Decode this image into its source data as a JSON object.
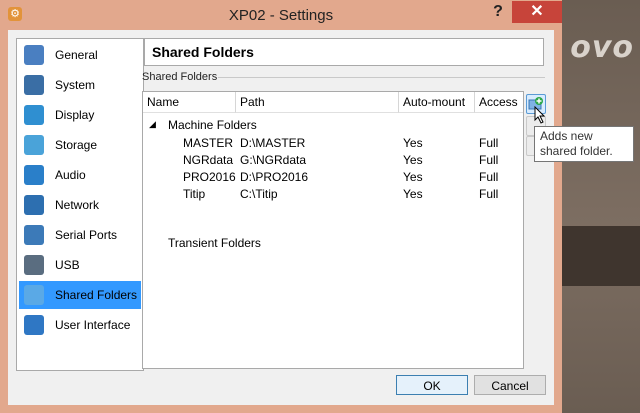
{
  "window": {
    "title": "XP02 - Settings",
    "help": "?",
    "close": "✕"
  },
  "desktop": {
    "brand": "ovo"
  },
  "nav": [
    {
      "label": "General",
      "icon": "general-icon",
      "color": "#4a7fc1"
    },
    {
      "label": "System",
      "icon": "chip-icon",
      "color": "#3a6ea5"
    },
    {
      "label": "Display",
      "icon": "monitor-icon",
      "color": "#2f8fd1"
    },
    {
      "label": "Storage",
      "icon": "disk-icon",
      "color": "#4aa3d9"
    },
    {
      "label": "Audio",
      "icon": "speaker-icon",
      "color": "#2a7fc9"
    },
    {
      "label": "Network",
      "icon": "network-icon",
      "color": "#2d6fb0"
    },
    {
      "label": "Serial Ports",
      "icon": "serial-port-icon",
      "color": "#3c7ab8"
    },
    {
      "label": "USB",
      "icon": "usb-icon",
      "color": "#5a6d80"
    },
    {
      "label": "Shared Folders",
      "icon": "folder-icon",
      "color": "#5aa9e6"
    },
    {
      "label": "User Interface",
      "icon": "ui-icon",
      "color": "#2f77c4"
    }
  ],
  "selected": "Shared Folders",
  "header": "Shared Folders",
  "group": "Shared Folders",
  "columns": [
    "Name",
    "Path",
    "Auto-mount",
    "Access"
  ],
  "machine_folders": "Machine Folders",
  "transient_folders": "Transient Folders",
  "folders": [
    {
      "name": "MASTER",
      "path": "D:\\MASTER",
      "auto": "Yes",
      "access": "Full"
    },
    {
      "name": "NGRdata",
      "path": "G:\\NGRdata",
      "auto": "Yes",
      "access": "Full"
    },
    {
      "name": "PRO2016",
      "path": "D:\\PRO2016",
      "auto": "Yes",
      "access": "Full"
    },
    {
      "name": "Titip",
      "path": "C:\\Titip",
      "auto": "Yes",
      "access": "Full"
    }
  ],
  "tooltip": "Adds new shared folder.",
  "buttons": {
    "ok": "OK",
    "cancel": "Cancel"
  }
}
